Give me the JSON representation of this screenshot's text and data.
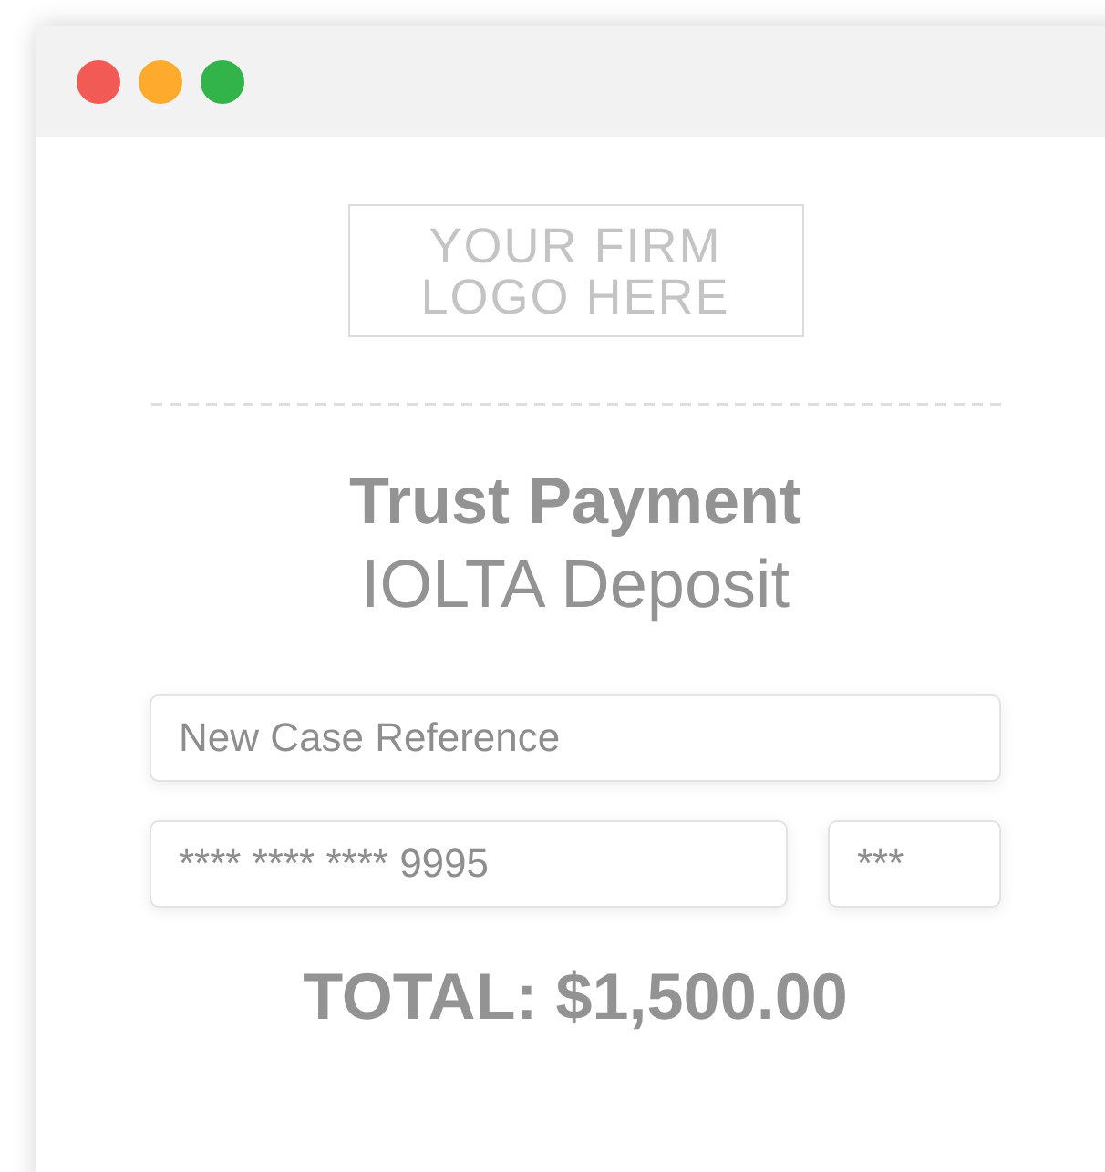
{
  "window": {
    "controls": [
      {
        "color": "#f25a55"
      },
      {
        "color": "#fdaa2d"
      },
      {
        "color": "#33b44a"
      }
    ]
  },
  "logo": {
    "lines": [
      "YOUR FIRM",
      "LOGO HERE"
    ]
  },
  "heading": {
    "title": "Trust Payment",
    "subtitle": "IOLTA Deposit"
  },
  "fields": [
    {
      "placeholder": "New Case Reference"
    },
    {
      "value": "**** **** **** 9995"
    },
    {
      "value": "***"
    }
  ],
  "total": "TOTAL: $1,500.00"
}
